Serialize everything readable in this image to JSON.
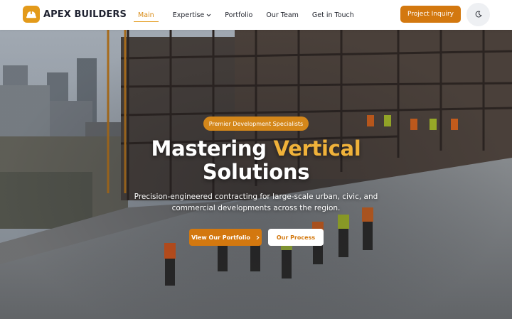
{
  "brand": {
    "name": "APEX BUILDERS",
    "icon": "hard-hat-icon",
    "accent": "#e39a1a"
  },
  "nav": {
    "items": [
      {
        "label": "Main",
        "active": true
      },
      {
        "label": "Expertise",
        "dropdown": true
      },
      {
        "label": "Portfolio"
      },
      {
        "label": "Our Team"
      },
      {
        "label": "Get in Touch"
      }
    ],
    "cta_label": "Project Inquiry",
    "theme_toggle_icon": "moon-icon"
  },
  "hero": {
    "badge": "Premier Development Specialists",
    "headline_line1_a": "Mastering ",
    "headline_line1_b": "Vertical",
    "headline_line2": "Solutions",
    "subtitle": "Precision-engineered contracting for large-scale urban, civic, and commercial developments across the region.",
    "primary_button": "View Our Portfolio",
    "secondary_button": "Our Process",
    "colors": {
      "primary": "#d3780f",
      "highlight": "#f0b23a"
    }
  }
}
